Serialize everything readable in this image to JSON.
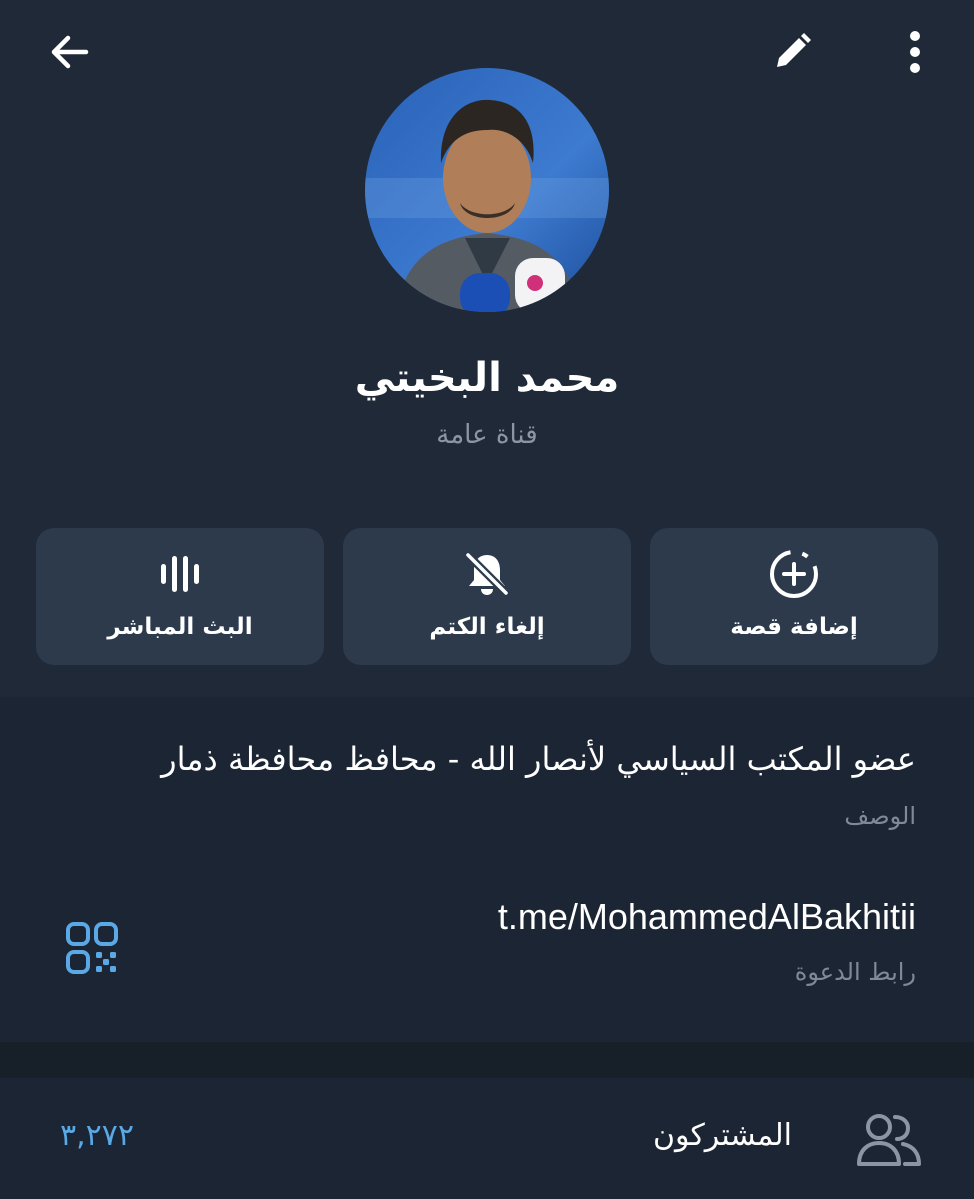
{
  "header": {
    "back_icon": "arrow-left-icon",
    "edit_icon": "pencil-icon",
    "more_icon": "more-vertical-icon"
  },
  "profile": {
    "name": "محمد البخيتي",
    "type": "قناة عامة"
  },
  "actions": [
    {
      "label": "البث المباشر",
      "icon": "live-stream-icon"
    },
    {
      "label": "إلغاء الكتم",
      "icon": "bell-off-icon"
    },
    {
      "label": "إضافة قصة",
      "icon": "add-story-icon"
    }
  ],
  "info": {
    "description": "عضو المكتب السياسي لأنصار الله - محافظ محافظة ذمار",
    "description_label": "الوصف",
    "link": "t.me/MohammedAlBakhitii",
    "link_label": "رابط الدعوة",
    "qr_icon": "qr-code-icon"
  },
  "subscribers": {
    "label": "المشتركون",
    "count": "٣,٢٧٢",
    "icon": "people-icon"
  },
  "colors": {
    "background": "#1f2937",
    "card": "#2c3a4c",
    "accent": "#5aa9e6",
    "muted": "#7f8a99"
  }
}
